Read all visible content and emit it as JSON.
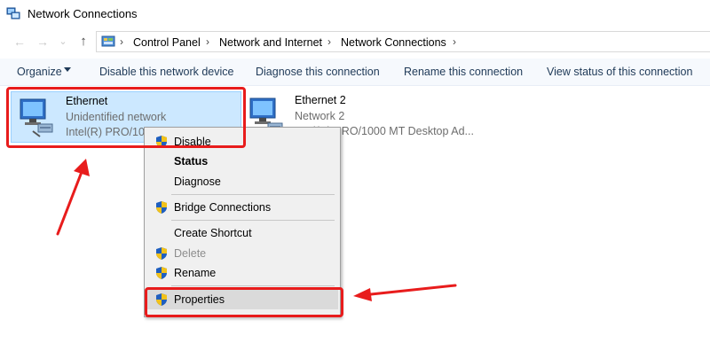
{
  "window": {
    "title": "Network Connections"
  },
  "nav": {
    "back_glyph": "←",
    "forward_glyph": "→",
    "dropdown_glyph": "⌄",
    "up_glyph": "↑"
  },
  "breadcrumbs": [
    "Control Panel",
    "Network and Internet",
    "Network Connections"
  ],
  "breadcrumb_separator": "›",
  "toolbar": {
    "organize": "Organize",
    "items": [
      "Disable this network device",
      "Diagnose this connection",
      "Rename this connection",
      "View status of this connection"
    ]
  },
  "connections": [
    {
      "name": "Ethernet",
      "status": "Unidentified network",
      "adapter": "Intel(R) PRO/1000 MT Desktop Ad...",
      "selected": true
    },
    {
      "name": "Ethernet 2",
      "status": "Network 2",
      "adapter": "Intel(R) PRO/1000 MT Desktop Ad...",
      "selected": false
    }
  ],
  "context_menu": {
    "items": [
      {
        "label": "Disable",
        "shield": true,
        "bold": false,
        "disabled": false
      },
      {
        "label": "Status",
        "shield": false,
        "bold": true,
        "disabled": false
      },
      {
        "label": "Diagnose",
        "shield": false,
        "bold": false,
        "disabled": false
      },
      {
        "label": "Bridge Connections",
        "shield": true,
        "bold": false,
        "disabled": false
      },
      {
        "label": "Create Shortcut",
        "shield": false,
        "bold": false,
        "disabled": false
      },
      {
        "label": "Delete",
        "shield": true,
        "bold": false,
        "disabled": true
      },
      {
        "label": "Rename",
        "shield": true,
        "bold": false,
        "disabled": false
      },
      {
        "label": "Properties",
        "shield": true,
        "bold": false,
        "disabled": false,
        "hovered": true
      }
    ]
  },
  "colors": {
    "annotation_red": "#e81c1c",
    "selection_bg": "#cce8ff",
    "toolbar_text": "#1e3957"
  },
  "icons": [
    "network-connections-icon",
    "back-arrow-icon",
    "forward-arrow-icon",
    "up-arrow-icon",
    "monitor-network-icon",
    "shield-icon",
    "annotation-arrow"
  ]
}
